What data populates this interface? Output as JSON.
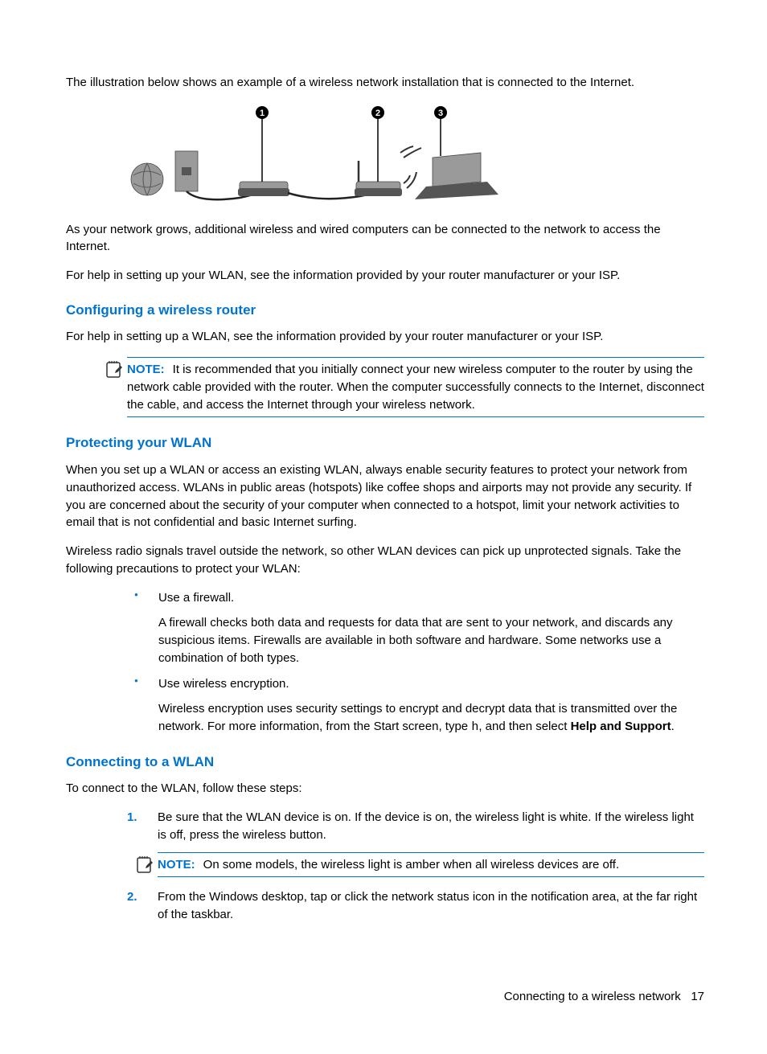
{
  "intro": {
    "p1": "The illustration below shows an example of a wireless network installation that is connected to the Internet.",
    "p2": "As your network grows, additional wireless and wired computers can be connected to the network to access the Internet.",
    "p3": "For help in setting up your WLAN, see the information provided by your router manufacturer or your ISP."
  },
  "sections": {
    "config": {
      "heading": "Configuring a wireless router",
      "p1": "For help in setting up a WLAN, see the information provided by your router manufacturer or your ISP.",
      "note_label": "NOTE:",
      "note_text": "It is recommended that you initially connect your new wireless computer to the router by using the network cable provided with the router. When the computer successfully connects to the Internet, disconnect the cable, and access the Internet through your wireless network."
    },
    "protect": {
      "heading": "Protecting your WLAN",
      "p1": "When you set up a WLAN or access an existing WLAN, always enable security features to protect your network from unauthorized access. WLANs in public areas (hotspots) like coffee shops and airports may not provide any security. If you are concerned about the security of your computer when connected to a hotspot, limit your network activities to email that is not confidential and basic Internet surfing.",
      "p2": "Wireless radio signals travel outside the network, so other WLAN devices can pick up unprotected signals. Take the following precautions to protect your WLAN:",
      "b1_lead": "Use a firewall.",
      "b1_detail": "A firewall checks both data and requests for data that are sent to your network, and discards any suspicious items. Firewalls are available in both software and hardware. Some networks use a combination of both types.",
      "b2_lead": "Use wireless encryption.",
      "b2_detail_pre": "Wireless encryption uses security settings to encrypt and decrypt data that is transmitted over the network. For more information, from the Start screen, type ",
      "b2_code": "h",
      "b2_detail_mid": ", and then select ",
      "b2_bold": "Help and Support",
      "b2_detail_post": "."
    },
    "connect": {
      "heading": "Connecting to a WLAN",
      "p1": "To connect to the WLAN, follow these steps:",
      "s1_num": "1.",
      "s1": "Be sure that the WLAN device is on. If the device is on, the wireless light is white. If the wireless light is off, press the wireless button.",
      "note_label": "NOTE:",
      "note_text": "On some models, the wireless light is amber when all wireless devices are off.",
      "s2_num": "2.",
      "s2": "From the Windows desktop, tap or click the network status icon in the notification area, at the far right of the taskbar."
    }
  },
  "footer": {
    "title": "Connecting to a wireless network",
    "page": "17"
  },
  "illustration": {
    "callouts": [
      "1",
      "2",
      "3"
    ]
  }
}
